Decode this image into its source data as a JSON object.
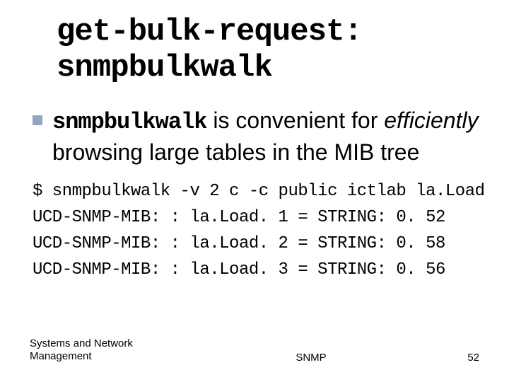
{
  "title": {
    "line1": "get-bulk-request:",
    "line2": "snmpbulkwalk"
  },
  "bullet": {
    "cmd": "snmpbulkwalk",
    "pre": " is convenient for ",
    "emph": "efficiently",
    "post": " browsing large tables in the MIB tree"
  },
  "code": {
    "l1": "$ snmpbulkwalk -v 2 c -c public ictlab la.Load",
    "l2": "UCD-SNMP-MIB: : la.Load. 1 = STRING: 0. 52",
    "l3": "UCD-SNMP-MIB: : la.Load. 2 = STRING: 0. 58",
    "l4": "UCD-SNMP-MIB: : la.Load. 3 = STRING: 0. 56"
  },
  "footer": {
    "left_l1": "Systems and Network",
    "left_l2": "Management",
    "center": "SNMP",
    "page": "52"
  }
}
